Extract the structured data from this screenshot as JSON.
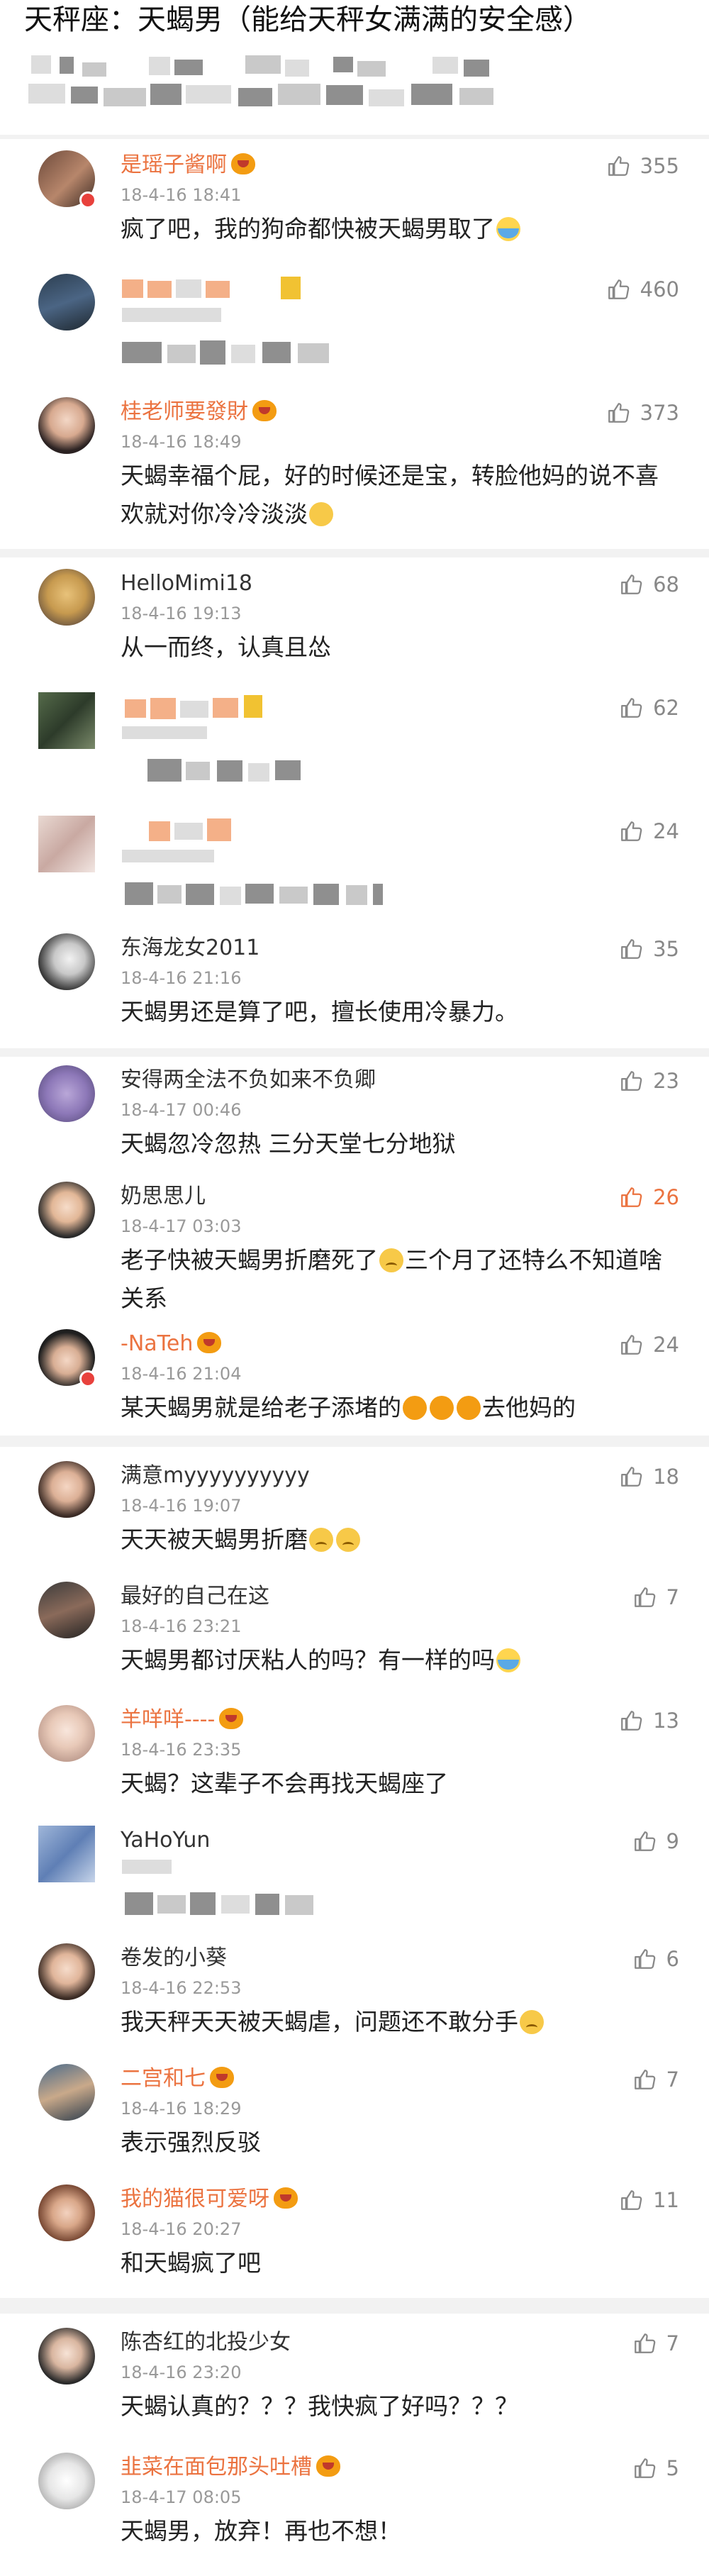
{
  "post": {
    "title": "天秤座：天蝎男（能给天秤女满满的安全感）"
  },
  "colors": {
    "vip_name": "#eb7340",
    "liked": "#eb7340",
    "meta": "#999999",
    "background": "#f2f2f2"
  },
  "comments": [
    {
      "name": "是瑶子酱啊",
      "time": "18-4-16 18:41",
      "text": "疯了吧，我的狗命都快被天蝎男取了",
      "likes": "355"
    },
    {
      "name": "",
      "time": "",
      "text": "",
      "likes": "460"
    },
    {
      "name": "桂老师要發財",
      "time": "18-4-16 18:49",
      "text": "天蝎幸福个屁，好的时候还是宝，转脸他妈的说不喜欢就对你冷冷淡淡",
      "likes": "373"
    },
    {
      "name": "HelloMimi18",
      "time": "18-4-16 19:13",
      "text": "从一而终，认真且怂",
      "likes": "68"
    },
    {
      "name": "",
      "time": "",
      "text": "",
      "likes": "62"
    },
    {
      "name": "",
      "time": "",
      "text": "",
      "likes": "24"
    },
    {
      "name": "东海龙女2011",
      "time": "18-4-16 21:16",
      "text": "天蝎男还是算了吧，擅长使用冷暴力。",
      "likes": "35"
    },
    {
      "name": "安得两全法不负如来不负卿",
      "time": "18-4-17 00:46",
      "text": "天蝎忽冷忽热 三分天堂七分地狱",
      "likes": "23"
    },
    {
      "name": "奶思思儿",
      "time": "18-4-17 03:03",
      "text": "老子快被天蝎男折磨死了",
      "text2": "三个月了还特么不知道啥关系",
      "likes": "26"
    },
    {
      "name": "-NaTeh",
      "time": "18-4-16 21:04",
      "text": "某天蝎男就是给老子添堵的",
      "text2": "去他妈的",
      "likes": "24"
    },
    {
      "name": "满意myyyyyyyyyy",
      "time": "18-4-16 19:07",
      "text": "天天被天蝎男折磨",
      "likes": "18"
    },
    {
      "name": "最好的自己在这",
      "time": "18-4-16 23:21",
      "text": "天蝎男都讨厌粘人的吗？有一样的吗",
      "likes": "7"
    },
    {
      "name": "羊咩咩----",
      "time": "18-4-16 23:35",
      "text": "天蝎？这辈子不会再找天蝎座了",
      "likes": "13"
    },
    {
      "name": "YaHoYun",
      "time": "",
      "text": "",
      "likes": "9"
    },
    {
      "name": "卷发的小葵",
      "time": "18-4-16 22:53",
      "text": "我天秤天天被天蝎虐，问题还不敢分手",
      "likes": "6"
    },
    {
      "name": "二宫和七",
      "time": "18-4-16 18:29",
      "text": "表示强烈反驳",
      "likes": "7"
    },
    {
      "name": "我的猫很可爱呀",
      "time": "18-4-16 20:27",
      "text": "和天蝎疯了吧",
      "likes": "11"
    },
    {
      "name": "陈杏红的北投少女",
      "time": "18-4-16 23:20",
      "text": "天蝎认真的？？？我快疯了好吗？？？",
      "likes": "7"
    },
    {
      "name": "韭菜在面包那头吐槽",
      "time": "18-4-17 08:05",
      "text": "天蝎男，放弃！再也不想！",
      "likes": "5"
    }
  ]
}
